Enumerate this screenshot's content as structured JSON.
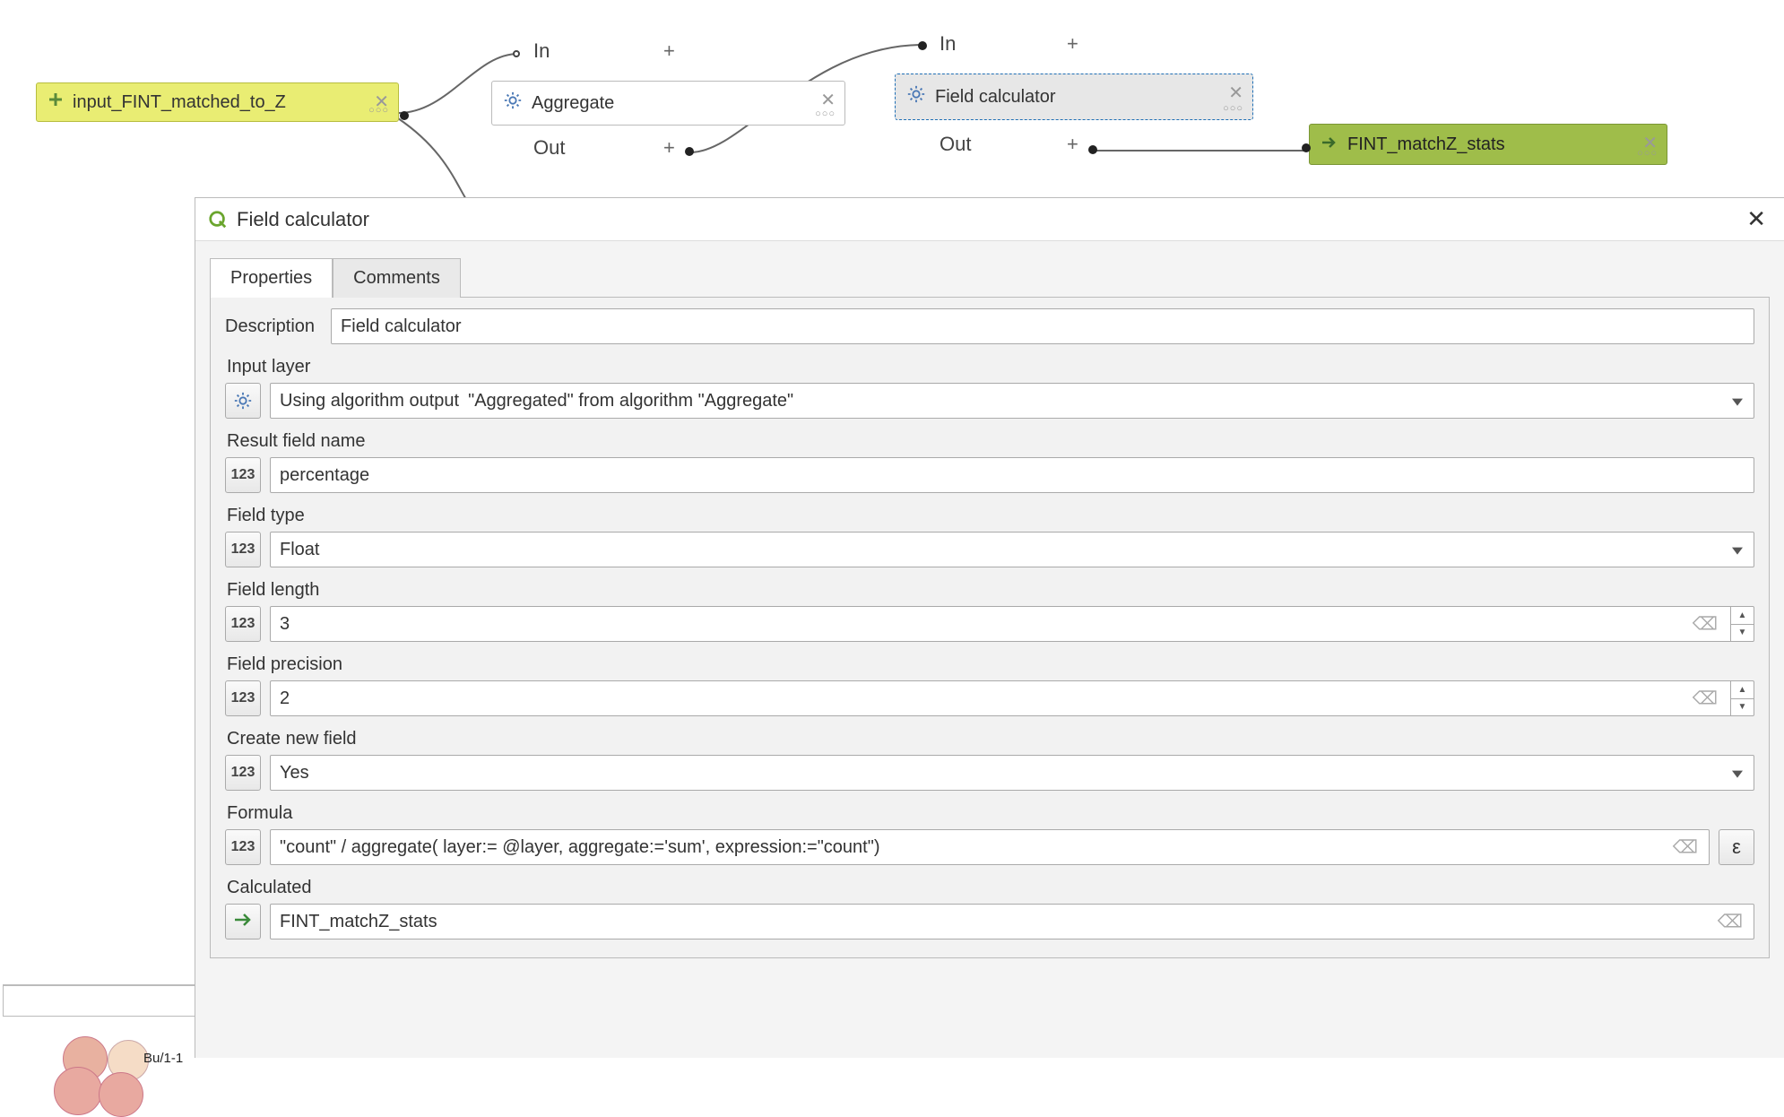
{
  "graph": {
    "input_node": "input_FINT_matched_to_Z",
    "algo1": {
      "name": "Aggregate",
      "in": "In",
      "out": "Out"
    },
    "algo2": {
      "name": "Field calculator",
      "in": "In",
      "out": "Out"
    },
    "output_node": "FINT_matchZ_stats"
  },
  "dialog": {
    "title": "Field calculator",
    "tabs": {
      "properties": "Properties",
      "comments": "Comments"
    },
    "description_label": "Description",
    "description_value": "Field calculator",
    "input_layer_label": "Input layer",
    "input_layer_prefix": "Using algorithm output",
    "input_layer_value": "\"Aggregated\" from algorithm \"Aggregate\"",
    "result_field_name_label": "Result field name",
    "result_field_name_value": "percentage",
    "field_type_label": "Field type",
    "field_type_value": "Float",
    "field_length_label": "Field length",
    "field_length_value": "3",
    "field_precision_label": "Field precision",
    "field_precision_value": "2",
    "create_new_field_label": "Create new field",
    "create_new_field_value": "Yes",
    "formula_label": "Formula",
    "formula_value": "\"count\" / aggregate( layer:= @layer, aggregate:='sum', expression:=\"count\")",
    "calculated_label": "Calculated",
    "calculated_value": "FINT_matchZ_stats",
    "type_badge": "123",
    "epsilon": "ε"
  },
  "bg_label": "Bu/1-1"
}
